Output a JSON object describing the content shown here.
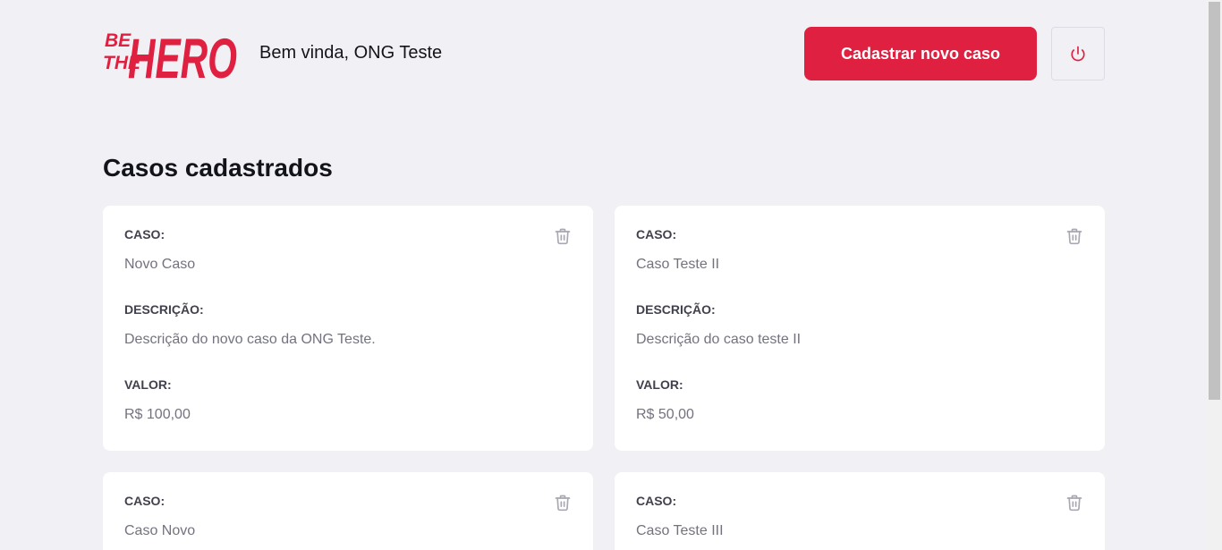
{
  "brand": {
    "logo_text": "BE THE HERO",
    "logo_color": "#e02041"
  },
  "header": {
    "welcome": "Bem vinda, ONG Teste",
    "new_case_label": "Cadastrar novo caso",
    "logout_icon": "power-icon"
  },
  "page": {
    "title": "Casos cadastrados"
  },
  "labels": {
    "case": "CASO:",
    "description": "DESCRIÇÃO:",
    "value": "VALOR:"
  },
  "incidents": [
    {
      "title": "Novo Caso",
      "description": "Descrição do novo caso da ONG Teste.",
      "value": "R$ 100,00"
    },
    {
      "title": "Caso Teste II",
      "description": "Descrição do caso teste II",
      "value": "R$ 50,00"
    },
    {
      "title": "Caso Novo"
    },
    {
      "title": "Caso Teste III"
    }
  ],
  "colors": {
    "background": "#f0f0f5",
    "accent": "#e02041",
    "card": "#ffffff",
    "label_text": "#41414d",
    "value_text": "#737380",
    "icon_gray": "#a8a8b3"
  }
}
